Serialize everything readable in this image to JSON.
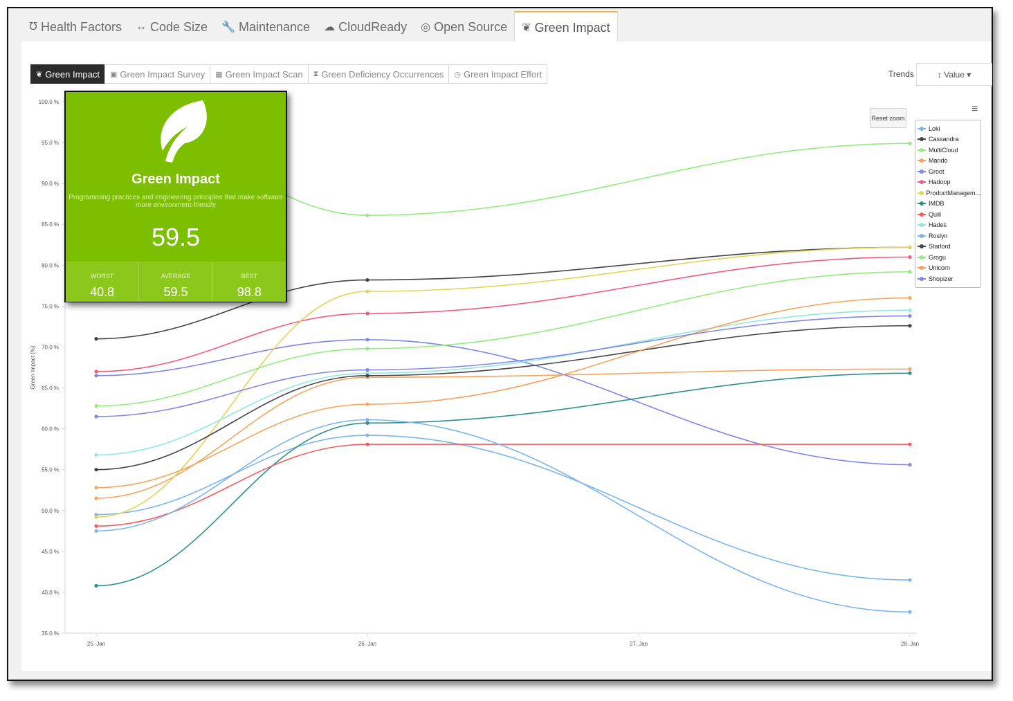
{
  "main_tabs": [
    {
      "label": "Health Factors",
      "icon": "stethoscope-icon",
      "glyph": "Ʊ"
    },
    {
      "label": "Code Size",
      "icon": "arrows-horizontal-icon",
      "glyph": "↔"
    },
    {
      "label": "Maintenance",
      "icon": "wrench-icon",
      "glyph": "🔧"
    },
    {
      "label": "CloudReady",
      "icon": "cloud-icon",
      "glyph": "☁"
    },
    {
      "label": "Open Source",
      "icon": "open-source-icon",
      "glyph": "◎"
    },
    {
      "label": "Green Impact",
      "icon": "leaf-icon",
      "glyph": "❦"
    }
  ],
  "sub_tabs": [
    {
      "label": "Green Impact",
      "icon": "leaf-icon",
      "glyph": "❦"
    },
    {
      "label": "Green Impact Survey",
      "icon": "briefcase-icon",
      "glyph": "▣"
    },
    {
      "label": "Green Impact Scan",
      "icon": "grid-icon",
      "glyph": "▦"
    },
    {
      "label": "Green Deficiency Occurrences",
      "icon": "hourglass-icon",
      "glyph": "⧗"
    },
    {
      "label": "Green Impact Effort",
      "icon": "clock-icon",
      "glyph": "◷"
    }
  ],
  "trends": {
    "label": "Trends :",
    "value": "↕ Value ▾"
  },
  "reset_zoom": "Reset zoom",
  "card": {
    "title": "Green Impact",
    "description": "Programming practices and engineering principles that make software more environment-friendly",
    "score": "59.5",
    "worst_label": "WORST",
    "worst": "40.8",
    "average_label": "AVERAGE",
    "average": "59.5",
    "best_label": "BEST",
    "best": "98.8",
    "color": "#7cbf00"
  },
  "chart_data": {
    "type": "line",
    "ylabel": "Green Impact (%)",
    "ylim": [
      35,
      100
    ],
    "yticks": [
      "35.0 %",
      "40.0 %",
      "45.0 %",
      "50.0 %",
      "55.0 %",
      "60.0 %",
      "65.0 %",
      "70.0 %",
      "75.0 %",
      "80.0 %",
      "85.0 %",
      "90.0 %",
      "95.0 %",
      "100.0 %"
    ],
    "x": [
      "25. Jan",
      "26. Jan",
      "27. Jan",
      "28. Jan"
    ],
    "grid": false,
    "legend": "right",
    "series": [
      {
        "name": "Loki",
        "color": "#7cb5ec",
        "values": [
          49.5,
          59.2,
          null,
          41.5
        ]
      },
      {
        "name": "Cassandra",
        "color": "#434348",
        "values": [
          71.0,
          78.2,
          null,
          82.2
        ]
      },
      {
        "name": "MultiCloud",
        "color": "#90ed7d",
        "values": [
          98.8,
          86.1,
          null,
          94.9
        ]
      },
      {
        "name": "Mando",
        "color": "#f7a35c",
        "values": [
          51.5,
          66.3,
          null,
          67.3
        ]
      },
      {
        "name": "Groot",
        "color": "#8085e9",
        "values": [
          66.5,
          70.9,
          null,
          55.6
        ]
      },
      {
        "name": "Hadoop",
        "color": "#f15c80",
        "values": [
          67.0,
          74.1,
          null,
          81.0
        ]
      },
      {
        "name": "ProductManagem...",
        "color": "#e4d354",
        "values": [
          49.2,
          76.8,
          null,
          82.2
        ]
      },
      {
        "name": "IMDB",
        "color": "#2b908f",
        "values": [
          40.8,
          60.7,
          null,
          66.8
        ]
      },
      {
        "name": "Quill",
        "color": "#f45b5b",
        "values": [
          48.1,
          58.1,
          null,
          58.1
        ]
      },
      {
        "name": "Hades",
        "color": "#91e8e1",
        "values": [
          56.8,
          66.8,
          null,
          74.5
        ]
      },
      {
        "name": "Roslyn",
        "color": "#7cb5ec",
        "values": [
          47.5,
          61.1,
          null,
          37.6
        ]
      },
      {
        "name": "Starlord",
        "color": "#434348",
        "values": [
          55.0,
          66.5,
          null,
          72.6
        ]
      },
      {
        "name": "Grogu",
        "color": "#90ed7d",
        "values": [
          62.8,
          69.8,
          null,
          79.2
        ]
      },
      {
        "name": "Unicorn",
        "color": "#f7a35c",
        "values": [
          52.8,
          63.0,
          null,
          76.0
        ]
      },
      {
        "name": "Shopizer",
        "color": "#8085e9",
        "values": [
          61.5,
          67.2,
          null,
          73.8
        ]
      }
    ]
  }
}
